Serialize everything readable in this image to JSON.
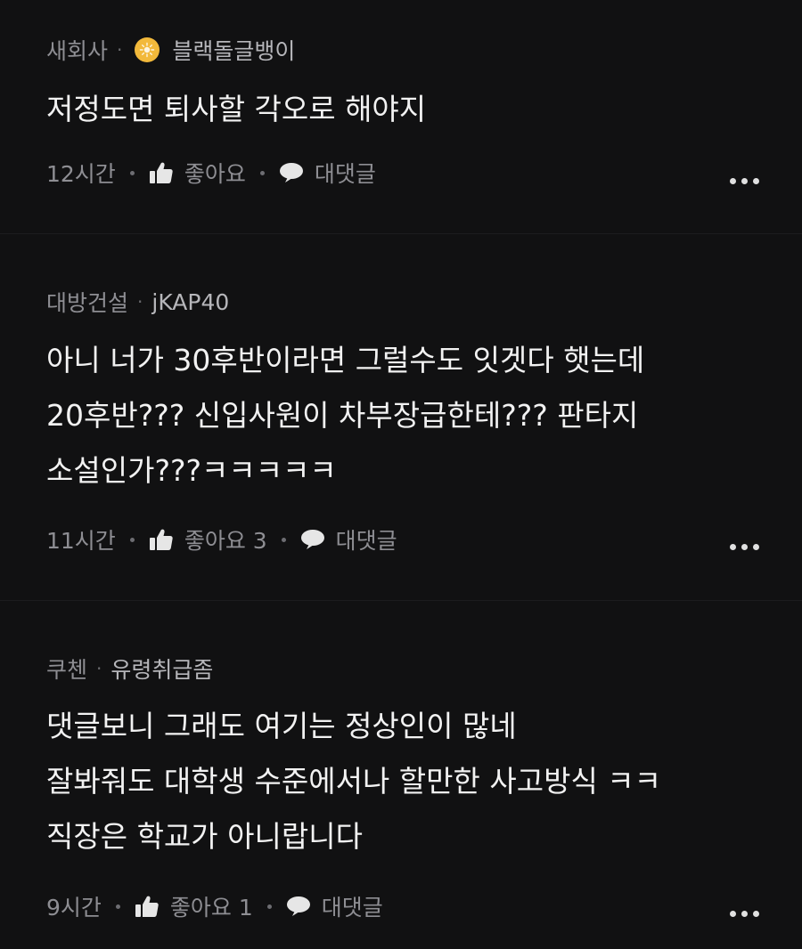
{
  "comments": [
    {
      "company": "새회사",
      "nickname": "블랙돌글뱅이",
      "has_badge": true,
      "lines": [
        "저정도면 퇴사할 각오로 해야지"
      ],
      "time": "12시간",
      "like_label": "좋아요",
      "reply_label": "대댓글"
    },
    {
      "company": "대방건설",
      "nickname": "jKAP40",
      "has_badge": false,
      "lines": [
        "아니 너가 30후반이라면 그럴수도 잇겟다 햇는데",
        "20후반??? 신입사원이 차부장급한테??? 판타지",
        "소설인가???ㅋㅋㅋㅋㅋ"
      ],
      "time": "11시간",
      "like_label": "좋아요 3",
      "reply_label": "대댓글"
    },
    {
      "company": "쿠첸",
      "nickname": "유령취급좀",
      "has_badge": false,
      "lines": [
        "댓글보니 그래도 여기는 정상인이 많네",
        "잘봐줘도 대학생 수준에서나 할만한 사고방식 ㅋㅋ",
        "직장은 학교가 아니랍니다"
      ],
      "time": "9시간",
      "like_label": "좋아요 1",
      "reply_label": "대댓글"
    }
  ],
  "icons": {
    "badge": "sun-badge-icon",
    "like": "thumbs-up-icon",
    "reply": "speech-bubble-icon",
    "more": "more-dots-icon"
  },
  "colors": {
    "background": "#111112",
    "badge": "#f2b93b",
    "meta_text": "#8e8e93",
    "body_text": "#f2f2f2"
  }
}
